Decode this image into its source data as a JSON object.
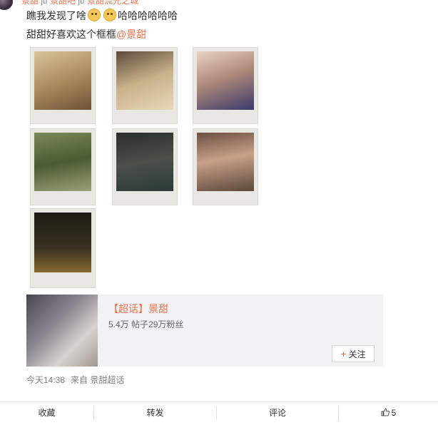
{
  "repost": {
    "segments": [
      {
        "text": "景甜",
        "kind": "name"
      },
      {
        "text": "jtf",
        "kind": "plain"
      },
      {
        "text": "景甜吧",
        "kind": "name"
      },
      {
        "text": "jtf",
        "kind": "plain"
      },
      {
        "text": "景甜",
        "kind": "name"
      },
      {
        "text": "流光之城",
        "kind": "name"
      }
    ]
  },
  "post": {
    "line1_a": "瞧我发现了啥",
    "line1_b": "哈哈哈哈哈哈",
    "line2": "甜甜好喜欢这个框框",
    "mention": "@景甜"
  },
  "photos": [
    "photo-1",
    "photo-2",
    "photo-3",
    "photo-4",
    "photo-5",
    "photo-6",
    "photo-7"
  ],
  "card": {
    "title": "【超话】景甜",
    "subtitle": "5.4万 帖子29万粉丝",
    "follow_label": "关注"
  },
  "meta": {
    "time": "今天14:38",
    "source": "来自 景甜超话"
  },
  "actions": {
    "favorite": "收藏",
    "repost": "转发",
    "comment": "评论",
    "like_count": "5"
  },
  "colors": {
    "accent": "#eb7350",
    "card_bg": "#f2f2f5",
    "muted": "#808080"
  }
}
